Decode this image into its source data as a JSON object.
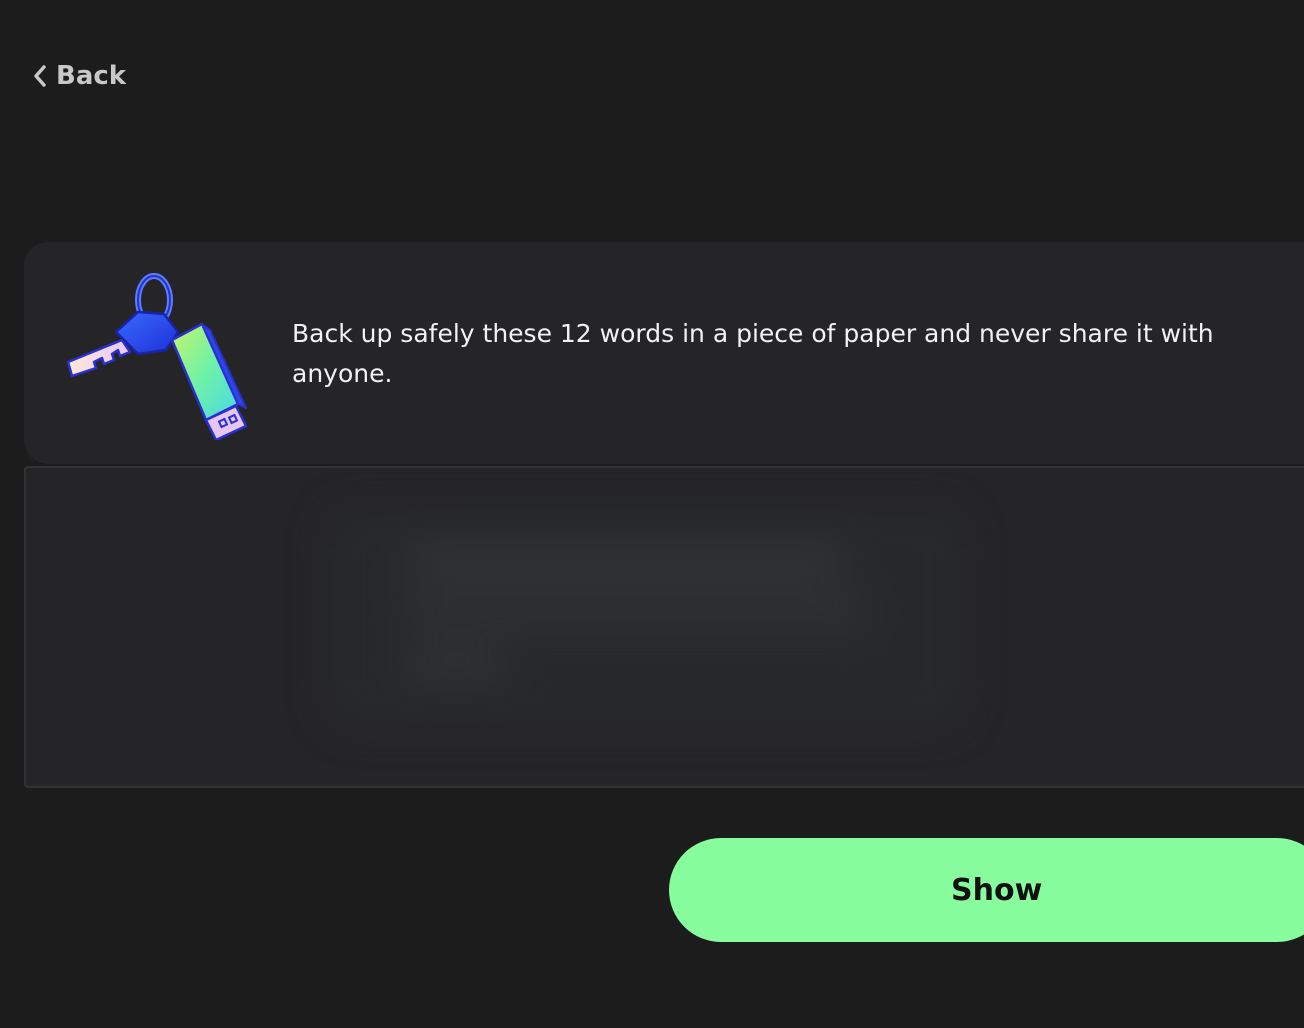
{
  "nav": {
    "back_label": "Back",
    "back_icon": "chevron-left-icon"
  },
  "info": {
    "illustration_icon": "keys-and-usb-icon",
    "message": "Back up safely these 12 words in a piece of paper and never share it with anyone."
  },
  "recovery_words": {
    "state": "hidden"
  },
  "actions": {
    "show_label": "Show"
  },
  "colors": {
    "background": "#1c1c1d",
    "card": "#252527",
    "accent": "#88fd9d",
    "text": "#f2f2f2",
    "muted": "#c8c8c8"
  }
}
